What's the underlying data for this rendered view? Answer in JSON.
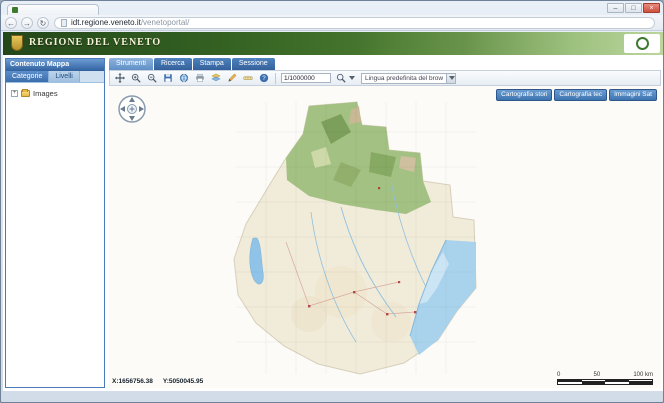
{
  "browser": {
    "url_host": "idt.regione.veneto.it",
    "url_path": "/venetoportal/",
    "icons": {
      "back": "←",
      "forward": "→",
      "reload": "↻",
      "minimize": "–",
      "maximize": "□",
      "close": "×",
      "expander": "+"
    }
  },
  "banner": {
    "title": "REGIONE DEL VENETO"
  },
  "sidebar": {
    "title": "Contenuto Mappa",
    "tabs": [
      {
        "label": "Categorie"
      },
      {
        "label": "Livelli"
      }
    ],
    "tree": [
      {
        "label": "Images"
      }
    ]
  },
  "toolbar": {
    "tabs": [
      {
        "label": "Strumenti"
      },
      {
        "label": "Ricerca"
      },
      {
        "label": "Stampa"
      },
      {
        "label": "Sessione"
      }
    ],
    "icon_names": [
      "pan",
      "zoom-in",
      "zoom-out",
      "save",
      "globe-refresh",
      "print",
      "layers",
      "draw",
      "measure",
      "help",
      "search"
    ],
    "scale_value": "1/1000000",
    "language_value": "Lingua predefinita del brow"
  },
  "map": {
    "layer_buttons": [
      {
        "label": "Cartografia stori"
      },
      {
        "label": "Cartografia tec"
      },
      {
        "label": "Immagini Sat"
      }
    ],
    "coord_x": "X:1656756.38",
    "coord_y": "Y:5050045.95",
    "scalebar": {
      "t0": "0",
      "t1": "50",
      "t2": "100 km"
    }
  },
  "colors": {
    "accent_blue": "#3e74b0",
    "banner_green": "#356323"
  }
}
